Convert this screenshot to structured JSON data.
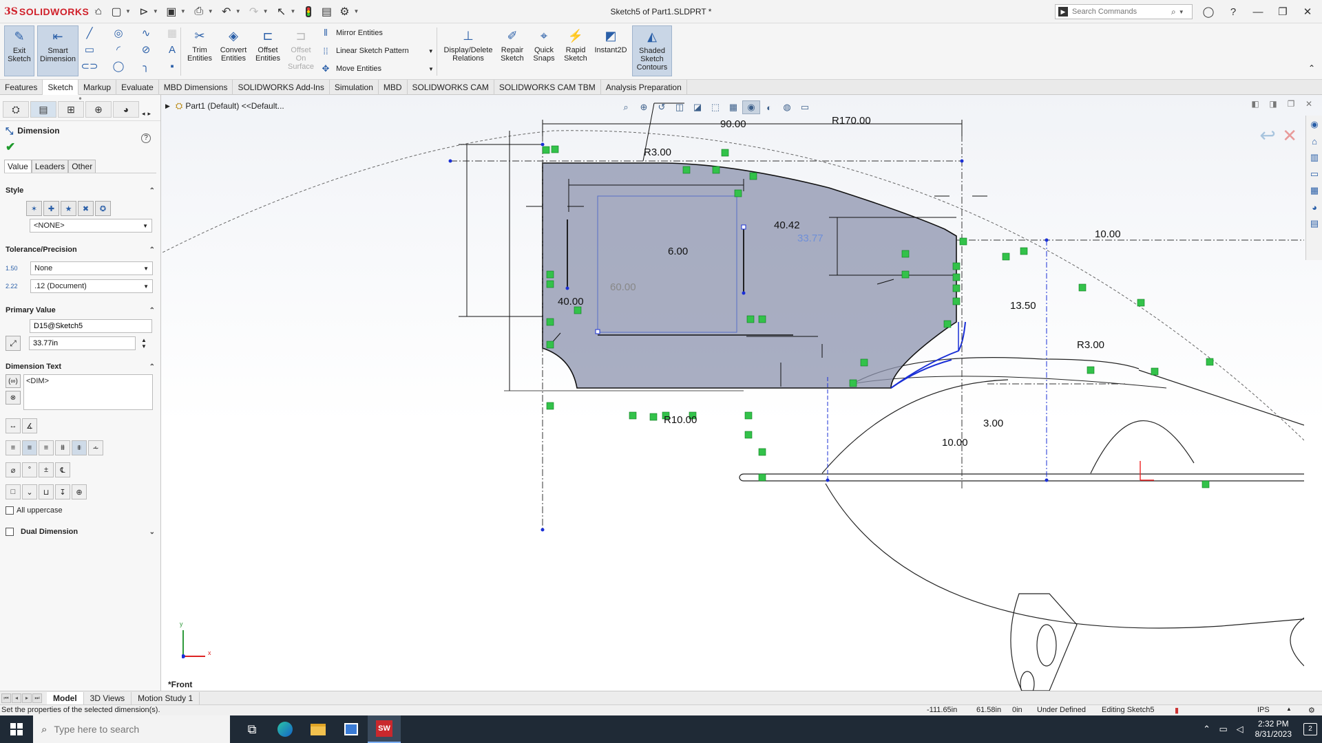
{
  "titlebar": {
    "brand": "SOLIDWORKS",
    "document_title": "Sketch5 of Part1.SLDPRT *",
    "search_placeholder": "Search Commands",
    "icons": [
      "home-icon",
      "new-icon",
      "open-icon",
      "save-icon",
      "print-icon",
      "undo-icon",
      "redo-icon",
      "select-icon",
      "rebuild-icon",
      "file-properties-icon",
      "options-icon"
    ]
  },
  "ribbon": {
    "exit_sketch": "Exit Sketch",
    "smart_dimension": "Smart Dimension",
    "trim_entities": "Trim Entities",
    "convert_entities": "Convert Entities",
    "offset_entities": "Offset Entities",
    "offset_on_surface": "Offset On Surface",
    "mirror_entities": "Mirror Entities",
    "linear_sketch_pattern": "Linear Sketch Pattern",
    "move_entities": "Move Entities",
    "display_delete_relations": "Display/Delete Relations",
    "repair_sketch": "Repair Sketch",
    "quick_snaps": "Quick Snaps",
    "rapid_sketch": "Rapid Sketch",
    "instant2d": "Instant2D",
    "shaded_sketch_contours": "Shaded Sketch Contours"
  },
  "tabs": [
    "Features",
    "Sketch",
    "Markup",
    "Evaluate",
    "MBD Dimensions",
    "SOLIDWORKS Add-Ins",
    "Simulation",
    "MBD",
    "SOLIDWORKS CAM",
    "SOLIDWORKS CAM TBM",
    "Analysis Preparation"
  ],
  "active_tab": "Sketch",
  "property_manager": {
    "title": "Dimension",
    "tabs": [
      "Value",
      "Leaders",
      "Other"
    ],
    "style": {
      "label": "Style",
      "selected": "<NONE>"
    },
    "tolerance": {
      "label": "Tolerance/Precision",
      "tolerance_type": "None",
      "precision": ".12 (Document)"
    },
    "primary_value": {
      "label": "Primary Value",
      "name": "D15@Sketch5",
      "value": "33.77in"
    },
    "dimension_text": {
      "label": "Dimension Text",
      "text": "<DIM>"
    },
    "all_uppercase": "All uppercase",
    "dual_dimension": "Dual Dimension"
  },
  "graphics": {
    "tree_flyout": "Part1 (Default) <<Default...",
    "view_label": "*Front",
    "triad": {
      "x": "x",
      "y": "y"
    },
    "dimensions": {
      "r170": "R170.00",
      "d90": "90.00",
      "r3_top": "R3.00",
      "d40_42": "40.42",
      "d33_77": "33.77",
      "d6": "6.00",
      "d40": "40.00",
      "d60": "60.00",
      "d10_right": "10.00",
      "d13_50": "13.50",
      "r3_right": "R3.00",
      "r10": "R10.00",
      "d3": "3.00",
      "d10_bottom": "10.00"
    }
  },
  "bottom_tabs": [
    "Model",
    "3D Views",
    "Motion Study 1"
  ],
  "active_bottom_tab": "Model",
  "status": {
    "message": "Set the properties of the selected dimension(s).",
    "x": "-111.65in",
    "y": "61.58in",
    "z": "0in",
    "state": "Under Defined",
    "editing": "Editing Sketch5",
    "units": "IPS"
  },
  "taskbar": {
    "search_placeholder": "Type here to search",
    "time": "2:32 PM",
    "date": "8/31/2023",
    "notifications": "2"
  }
}
